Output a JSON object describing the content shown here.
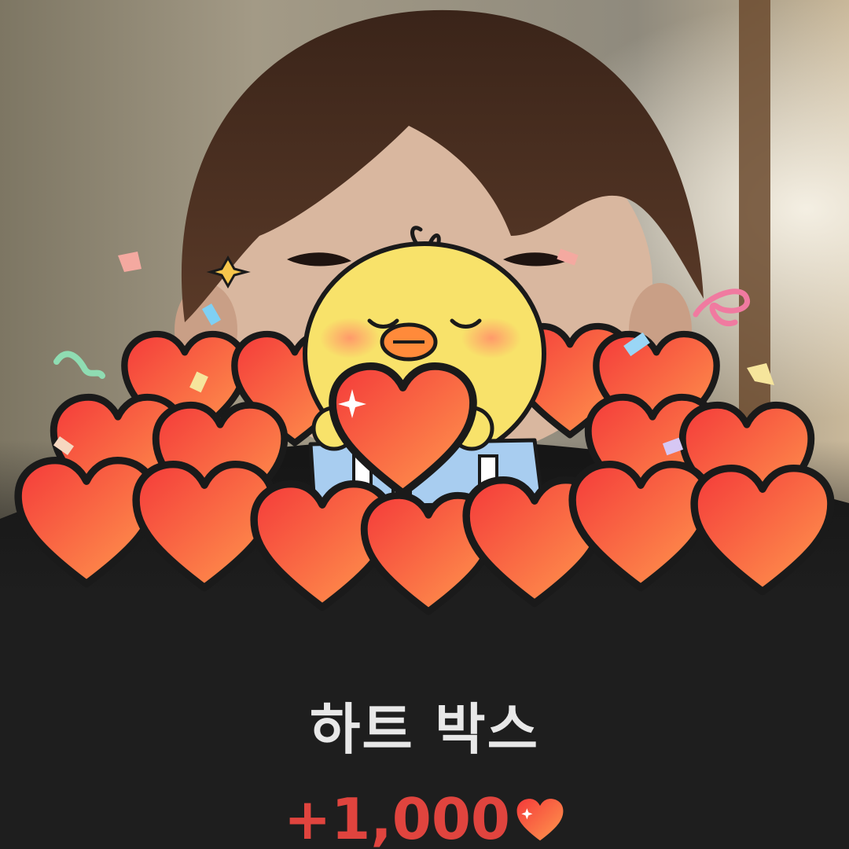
{
  "reward": {
    "title": "하트 박스",
    "amount": "+1,000",
    "currency_icon": "heart-icon"
  },
  "colors": {
    "background": "#1e1e1e",
    "title": "#e8e8e8",
    "amount": "#e0443e",
    "heart_light": "#ff8a4a",
    "heart_dark": "#f43a3a",
    "chick": "#f8e26a"
  },
  "illustration": {
    "character": "yellow-chick-icon",
    "props": [
      "heart-pile",
      "gift-box",
      "confetti"
    ]
  }
}
